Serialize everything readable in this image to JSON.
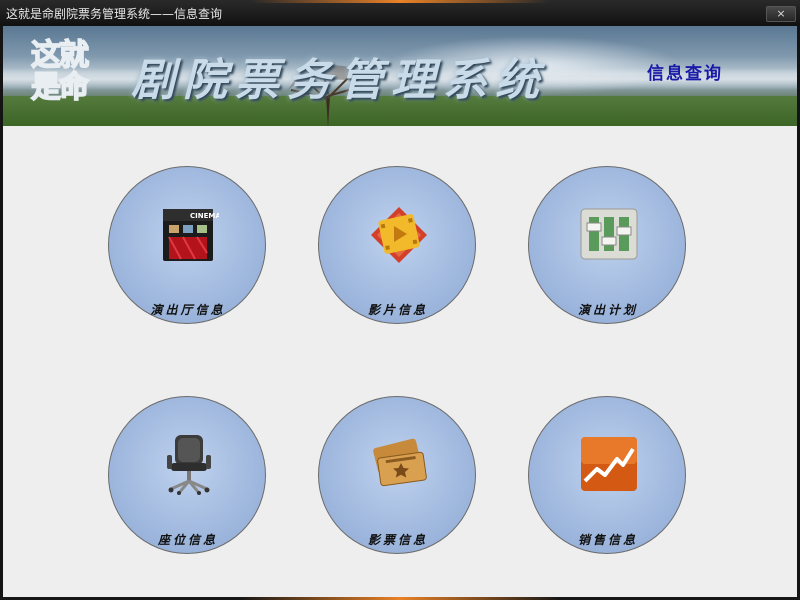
{
  "window": {
    "title": "这就是命剧院票务管理系统——信息查询",
    "close_label": "×"
  },
  "banner": {
    "logo_text_line1": "这就",
    "logo_text_line2": "是命",
    "title": "剧院票务管理系统",
    "subtitle": "信息查询"
  },
  "tiles": [
    {
      "label": "演出厅信息",
      "icon": "cinema-icon",
      "icon_text": "CINEMA"
    },
    {
      "label": "影片信息",
      "icon": "film-play-icon"
    },
    {
      "label": "演出计划",
      "icon": "equalizer-sliders-icon"
    },
    {
      "label": "座位信息",
      "icon": "office-chair-icon"
    },
    {
      "label": "影票信息",
      "icon": "tickets-icon"
    },
    {
      "label": "销售信息",
      "icon": "sales-chart-icon"
    }
  ],
  "colors": {
    "tile_fill": "#a2badf",
    "subtitle": "#1a1aa8",
    "content_bg": "#eeeeee",
    "titlebar": "#1a1a1a"
  }
}
